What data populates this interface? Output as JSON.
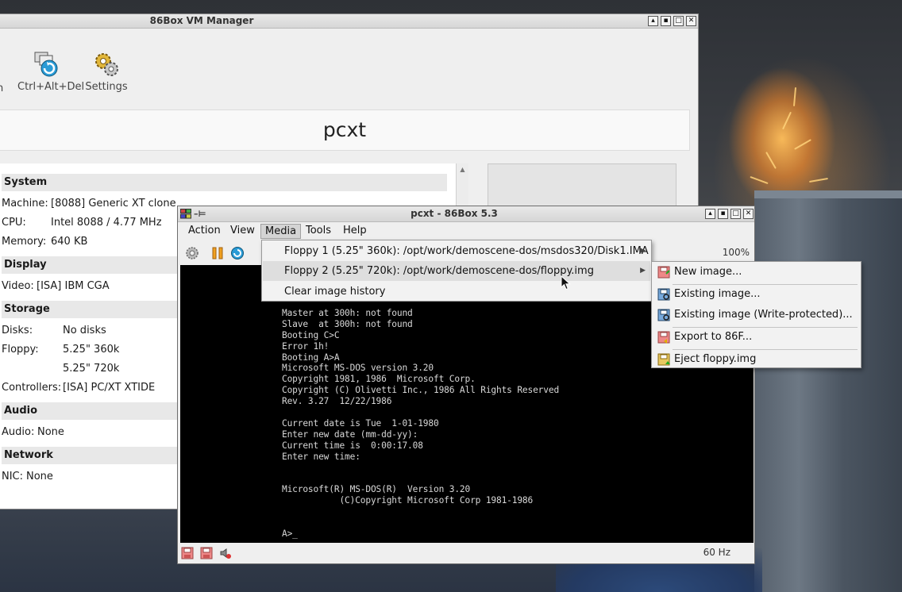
{
  "manager": {
    "title": "86Box VM Manager",
    "toolbar": {
      "partial_label": "n",
      "ctrl_alt_del_label": "Ctrl+Alt+Del",
      "settings_label": "Settings"
    },
    "vm_name": "pcxt",
    "details": {
      "system": {
        "heading": "System",
        "machine_label": "Machine:",
        "machine": "[8088] Generic XT clone",
        "cpu_label": "CPU:",
        "cpu": "Intel 8088 / 4.77 MHz",
        "memory_label": "Memory:",
        "memory": "640 KB"
      },
      "display": {
        "heading": "Display",
        "video_label": "Video:",
        "video": "[ISA] IBM CGA"
      },
      "storage": {
        "heading": "Storage",
        "disks_label": "Disks:",
        "disks": "No disks",
        "floppy_label": "Floppy:",
        "floppy1": "5.25\" 360k",
        "floppy2": "5.25\" 720k",
        "controllers_label": "Controllers:",
        "controllers": "[ISA] PC/XT XTIDE"
      },
      "audio": {
        "heading": "Audio",
        "audio_label": "Audio:",
        "audio": "None"
      },
      "network": {
        "heading": "Network",
        "nic_label": "NIC:",
        "nic": "None"
      }
    }
  },
  "emulator": {
    "title": "pcxt - 86Box 5.3",
    "menus": [
      "Action",
      "View",
      "Media",
      "Tools",
      "Help"
    ],
    "zoom": "100%",
    "refresh_rate": "60 Hz",
    "console_lines": [
      "Master at 300h: not found",
      "Slave  at 300h: not found",
      "Booting C>C",
      "Error 1h!",
      "Booting A>A",
      "Microsoft MS-DOS version 3.20",
      "Copyright 1981, 1986  Microsoft Corp.",
      "Copyright (C) Olivetti Inc., 1986 All Rights Reserved",
      "Rev. 3.27  12/22/1986",
      "",
      "Current date is Tue  1-01-1980",
      "Enter new date (mm-dd-yy):",
      "Current time is  0:00:17.08",
      "Enter new time:",
      "",
      "",
      "Microsoft(R) MS-DOS(R)  Version 3.20",
      "           (C)Copyright Microsoft Corp 1981-1986",
      "",
      "",
      "A>_"
    ]
  },
  "media_menu": {
    "items": [
      "Floppy 1 (5.25\" 360k): /opt/work/demoscene-dos/msdos320/Disk1.IMA",
      "Floppy 2 (5.25\" 720k): /opt/work/demoscene-dos/floppy.img",
      "Clear image history"
    ]
  },
  "floppy_submenu": {
    "items": [
      "New image...",
      "Existing image...",
      "Existing image (Write-protected)...",
      "Export to 86F...",
      "Eject floppy.img"
    ]
  }
}
